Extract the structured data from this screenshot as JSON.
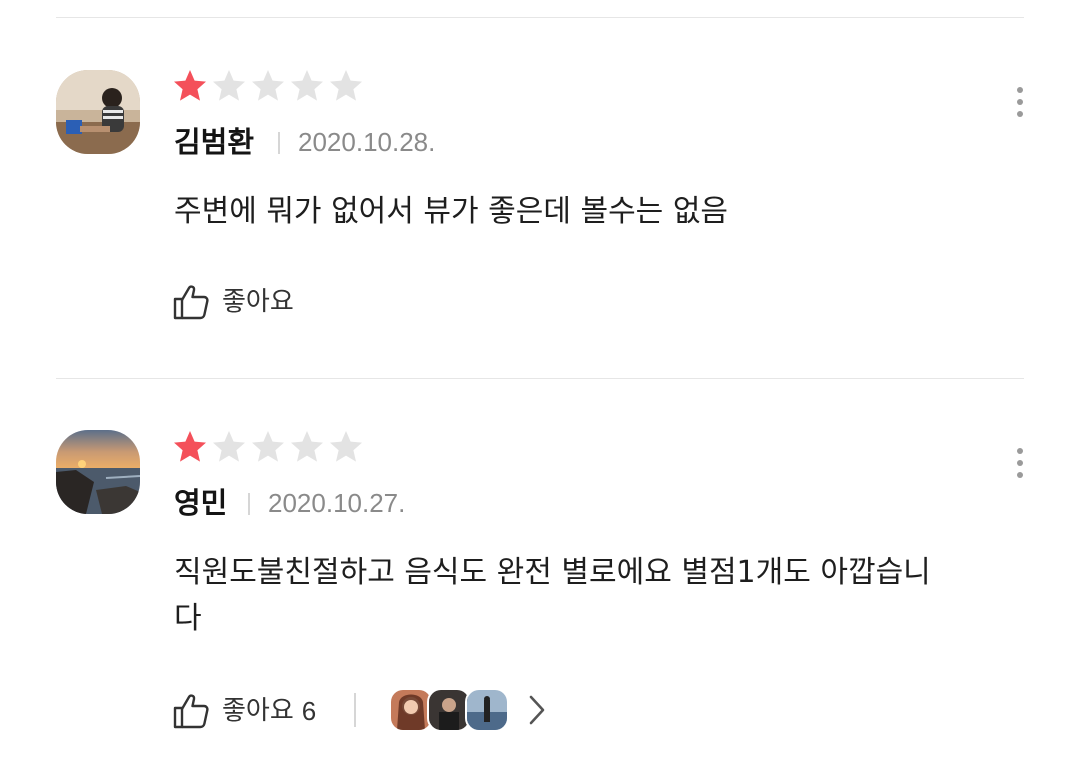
{
  "reviews": [
    {
      "author": "김범환",
      "date": "2020.10.28.",
      "rating": 1,
      "max_rating": 5,
      "text": "주변에 뭐가 없어서 뷰가 좋은데 볼수는 없음",
      "like_label": "좋아요",
      "like_count": "",
      "avatar_icon": "person-at-desk-photo",
      "more_icon": "more-vertical-icon"
    },
    {
      "author": "영민",
      "date": "2020.10.27.",
      "rating": 1,
      "max_rating": 5,
      "text_line1": "직원도불친절하고 음식도 완전 별로에요 별점1개도 아깝습니",
      "text_line2": "다",
      "like_label": "좋아요",
      "like_count": "6",
      "avatar_icon": "sunset-seascape-photo",
      "more_icon": "more-vertical-icon",
      "likers_icon": "liker-avatars"
    }
  ],
  "colors": {
    "star_filled": "#f4505a",
    "star_empty": "#e3e3e3",
    "divider": "#e6e6e6",
    "date": "#8a8a8a"
  }
}
